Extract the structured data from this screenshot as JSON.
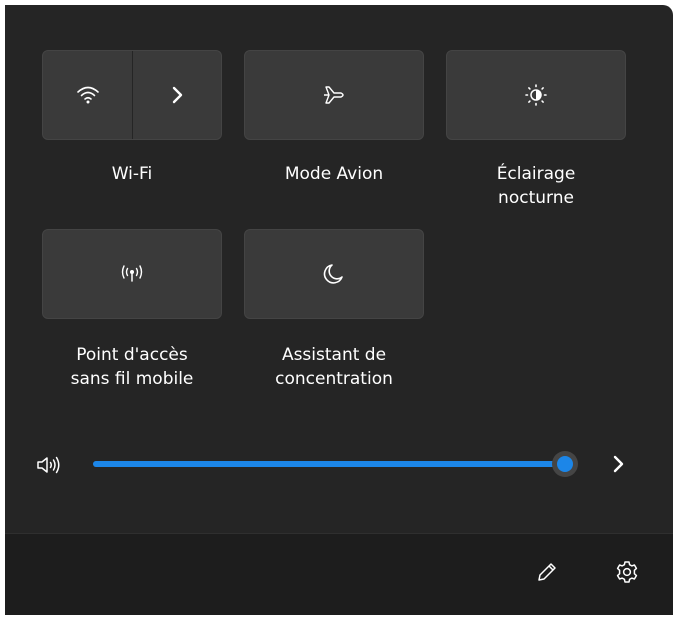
{
  "quick_settings": {
    "tiles": [
      {
        "id": "wifi",
        "label": "Wi-Fi",
        "icon": "wifi-icon",
        "secondary_icon": "chevron-right-icon",
        "state": "off"
      },
      {
        "id": "airplane",
        "label": "Mode Avion",
        "icon": "airplane-icon",
        "state": "off"
      },
      {
        "id": "night_light",
        "label": "Éclairage nocturne",
        "label_lines": [
          "Éclairage",
          "nocturne"
        ],
        "icon": "brightness-icon",
        "state": "off"
      },
      {
        "id": "hotspot",
        "label": "Point d'accès sans fil mobile",
        "label_lines": [
          "Point d'accès",
          "sans fil mobile"
        ],
        "icon": "hotspot-icon",
        "state": "off"
      },
      {
        "id": "focus_assist",
        "label": "Assistant de concentration",
        "label_lines": [
          "Assistant de",
          "concentration"
        ],
        "icon": "moon-icon",
        "state": "off"
      }
    ]
  },
  "volume": {
    "icon": "speaker-icon",
    "level_percent": 100,
    "expand_icon": "chevron-right-icon"
  },
  "footer": {
    "edit_icon": "pencil-icon",
    "settings_icon": "gear-icon"
  },
  "colors": {
    "panel_bg": "#252525",
    "tile_bg": "#3a3a3a",
    "footer_bg": "#1d1d1d",
    "accent": "#1c86e8",
    "text": "#ffffff"
  }
}
